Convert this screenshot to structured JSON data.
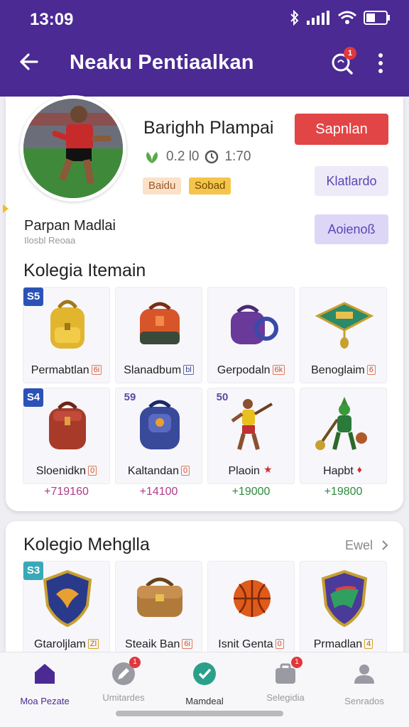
{
  "status_bar": {
    "time": "13:09"
  },
  "app_bar": {
    "title": "Neaku Pentiaalkan",
    "search_badge": "1"
  },
  "profile": {
    "name": "Barighh Plampai",
    "primary_button": "Sapnlan",
    "stat1": "0.2 l0",
    "stat2": "1:70",
    "tag1": "Baidu",
    "tag2": "Sobad",
    "button2": "Klatlardo",
    "button3": "Aoienoß",
    "subname": "Parpan Madlai",
    "subname2": "Ilosbl Reoaa"
  },
  "section1": {
    "title": "Kolegia Itemain",
    "items": [
      {
        "rank": "S5",
        "rank_color": "#2b52b8",
        "label": "Permabtlan",
        "mini": "6i",
        "art": "yellow-backpack"
      },
      {
        "rank": "",
        "rank_color": "",
        "label": "Slanadbum",
        "mini": "bl",
        "art": "orange-backpack"
      },
      {
        "rank": "",
        "rank_color": "",
        "label": "Gerpodaln",
        "mini": "6k",
        "art": "purple-bag"
      },
      {
        "rank": "",
        "rank_color": "",
        "label": "Benoglaim",
        "mini": "6",
        "art": "green-amulet"
      },
      {
        "rank": "S4",
        "rank_color": "#2b52b8",
        "label": "Sloenidkn",
        "mini": "0",
        "art": "red-backpack"
      },
      {
        "rank": "59",
        "rank_color": "",
        "label": "Kaltandan",
        "mini": "0",
        "art": "blue-backpack"
      },
      {
        "rank": "50",
        "rank_color": "",
        "label": "Plaoin",
        "mini": "★",
        "art": "athlete-figure"
      },
      {
        "rank": "",
        "rank_color": "",
        "label": "Hapbt",
        "mini": "♦",
        "art": "goblin-figure"
      }
    ],
    "prices": [
      {
        "text": "+719160",
        "color": "#b03a8a"
      },
      {
        "text": "+14100",
        "color": "#b03a8a"
      },
      {
        "text": "+19000",
        "color": "#2e8a3e"
      },
      {
        "text": "+19800",
        "color": "#2e8a3e"
      }
    ]
  },
  "section2": {
    "title": "Kolegio Mehglla",
    "view_all": "Ewel",
    "items": [
      {
        "rank": "S3",
        "rank_color": "#39a9b8",
        "label": "Gtaroljlam",
        "mini": "Zl",
        "art": "crest-shield"
      },
      {
        "rank": "",
        "rank_color": "",
        "label": "Steaik Ban",
        "mini": "6i",
        "art": "leather-bag"
      },
      {
        "rank": "",
        "rank_color": "",
        "label": "Isnit Genta",
        "mini": "0",
        "art": "basketball"
      },
      {
        "rank": "",
        "rank_color": "",
        "label": "Prmadlan",
        "mini": "4",
        "art": "team-shield"
      }
    ]
  },
  "bottom_nav": [
    {
      "label": "Moa Pezate",
      "active": true,
      "badge": ""
    },
    {
      "label": "Umitardes",
      "active": false,
      "badge": "1"
    },
    {
      "label": "Mamdeal",
      "active": false,
      "badge": ""
    },
    {
      "label": "Selegidia",
      "active": false,
      "badge": "1"
    },
    {
      "label": "Senrados",
      "active": false,
      "badge": ""
    }
  ],
  "colors": {
    "header": "#4b2a93",
    "accent_red": "#e24545",
    "lavender": "#ddd6f6"
  }
}
